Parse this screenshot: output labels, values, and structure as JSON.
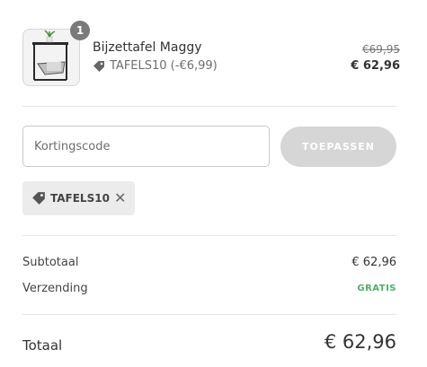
{
  "cart": {
    "quantity": "1",
    "product_name": "Bijzettafel Maggy",
    "discount_label": "TAFELS10 (-€6,99)",
    "original_price": "€69,95",
    "discounted_price": "€ 62,96"
  },
  "discount_form": {
    "placeholder": "Kortingscode",
    "value": "",
    "apply_label": "TOEPASSEN"
  },
  "applied_code": {
    "code": "TAFELS10",
    "remove_glyph": "✕"
  },
  "summary": {
    "subtotal_label": "Subtotaal",
    "subtotal_value": "€ 62,96",
    "shipping_label": "Verzending",
    "shipping_value": "GRATIS",
    "total_label": "Totaal",
    "total_value": "€ 62,96"
  },
  "colors": {
    "free_shipping": "#4caf6a",
    "apply_button_disabled": "#d6d6d6",
    "badge": "#7a7a7a"
  },
  "icons": {
    "tag": "tag-icon",
    "close": "close-icon"
  }
}
